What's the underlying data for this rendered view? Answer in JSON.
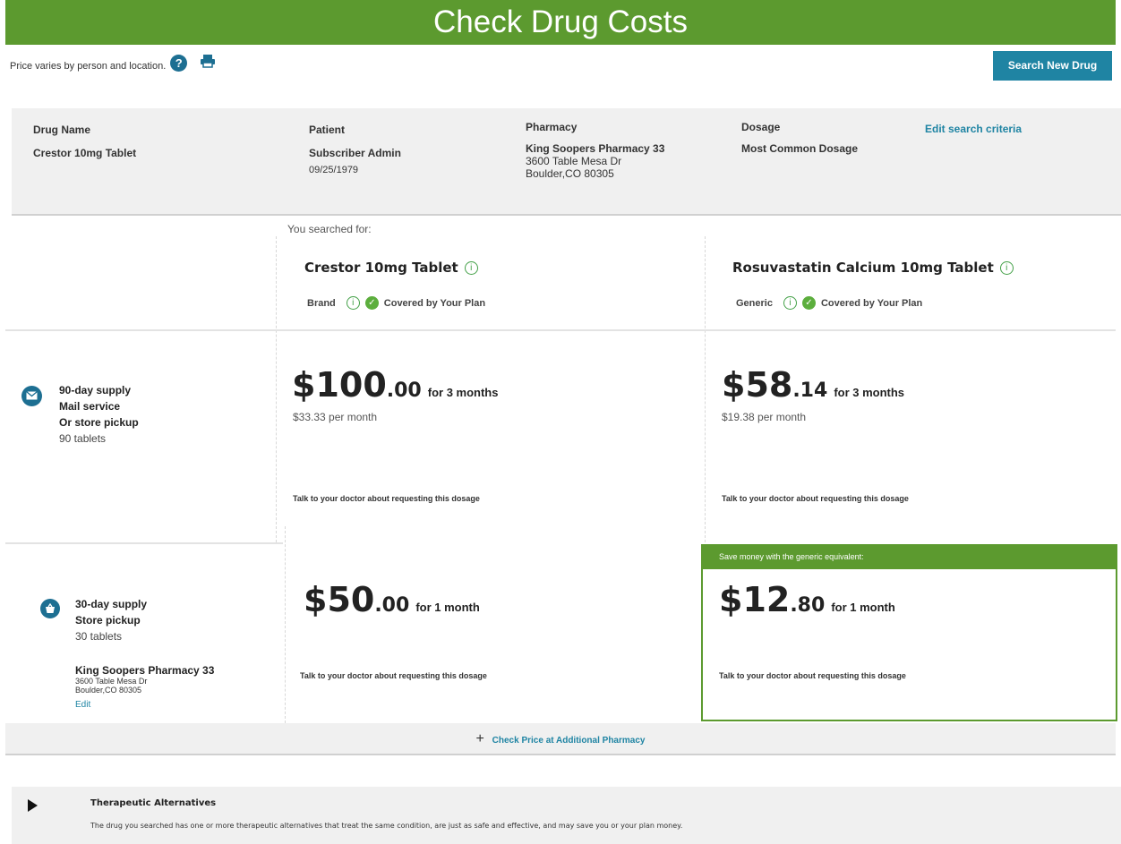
{
  "header": {
    "title": "Check Drug Costs"
  },
  "subline": {
    "text": "Price varies by person and location.",
    "help_glyph": "?",
    "print_icon": "printer-icon"
  },
  "search_button": {
    "label": "Search New Drug"
  },
  "criteria": {
    "drug_name": {
      "heading": "Drug Name",
      "value": "Crestor 10mg Tablet"
    },
    "patient": {
      "heading": "Patient",
      "name": "Subscriber Admin",
      "dob": "09/25/1979"
    },
    "pharmacy": {
      "heading": "Pharmacy",
      "name": "King Soopers Pharmacy 33",
      "address1": "3600 Table Mesa Dr",
      "address2": "Boulder,CO 80305"
    },
    "dosage": {
      "heading": "Dosage",
      "value": "Most Common Dosage"
    },
    "edit_label": "Edit search criteria"
  },
  "searched_label": "You searched for:",
  "drugs": [
    {
      "name": "Crestor 10mg Tablet",
      "type": "Brand",
      "coverage": "Covered by Your Plan"
    },
    {
      "name": "Rosuvastatin Calcium 10mg Tablet",
      "type": "Generic",
      "coverage": "Covered by Your Plan"
    }
  ],
  "supply90": {
    "line1": "90-day supply",
    "line2": "Mail service",
    "line3": "Or store pickup",
    "qty": "90 tablets",
    "brand": {
      "dollars": "$100",
      "cents": ".00",
      "period": "for 3 months",
      "monthly": "$33.33 per month",
      "note": "Talk to your doctor about requesting this dosage"
    },
    "generic": {
      "dollars": "$58",
      "cents": ".14",
      "period": "for 3 months",
      "monthly": "$19.38 per month",
      "note": "Talk to your doctor about requesting this dosage"
    }
  },
  "supply30": {
    "line1": "30-day supply",
    "line2": "Store pickup",
    "qty": "30 tablets",
    "pharmacy_name": "King Soopers Pharmacy 33",
    "pharmacy_addr1": "3600 Table Mesa Dr",
    "pharmacy_addr2": "Boulder,CO 80305",
    "edit_label": "Edit",
    "brand": {
      "dollars": "$50",
      "cents": ".00",
      "period": "for 1 month",
      "note": "Talk to your doctor about requesting this dosage"
    },
    "generic": {
      "banner": "Save money with the generic equivalent:",
      "dollars": "$12",
      "cents": ".80",
      "period": "for 1 month",
      "note": "Talk to your doctor about requesting this dosage"
    }
  },
  "additional_pharmacy": {
    "plus": "+",
    "label": "Check Price at Additional Pharmacy"
  },
  "alternatives": {
    "title": "Therapeutic Alternatives",
    "description": "The drug you searched has one or more therapeutic alternatives that treat the same condition, are just as safe and effective, and may save you or your plan money."
  },
  "colors": {
    "brand_green": "#5c9a2f",
    "link_blue": "#1f84a3",
    "icon_blue": "#1d6f92",
    "check_green": "#5cae3d"
  }
}
